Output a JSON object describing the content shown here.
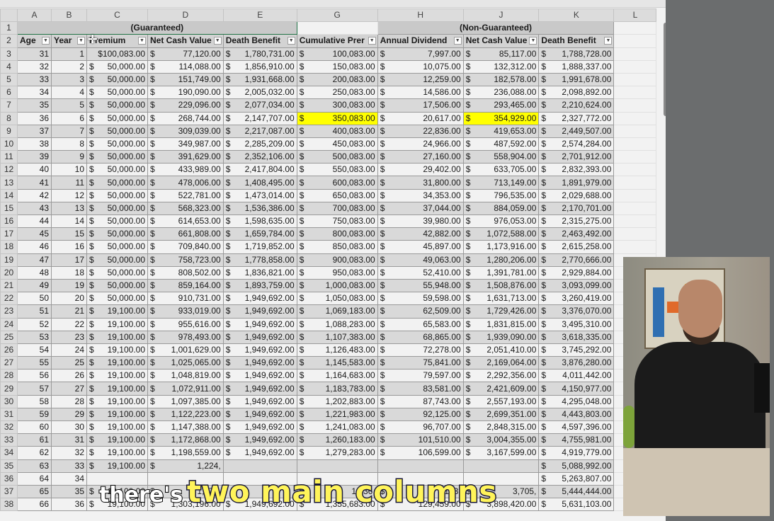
{
  "column_letters": [
    "A",
    "B",
    "C",
    "D",
    "E",
    "G",
    "H",
    "J",
    "K",
    "L"
  ],
  "group_headers": {
    "guaranteed": "(Guaranteed)",
    "non_guaranteed": "(Non-Guaranteed)"
  },
  "headers": [
    "Age",
    "Year",
    "Premium",
    "Net Cash Value",
    "Death Benefit",
    "Cumulative Prer",
    "Annual Dividend",
    "Net Cash Value",
    "Death Benefit"
  ],
  "currency_symbol": "$",
  "rows": [
    {
      "row": "3",
      "age": "31",
      "year": "1",
      "premium": "$100,083.00",
      "ncv": "77,120.00",
      "db": "1,780,731.00",
      "cum": "100,083.00",
      "div": "7,997.00",
      "ncv2": "85,117.00",
      "db2": "1,788,728.00"
    },
    {
      "row": "4",
      "age": "32",
      "year": "2",
      "premium": "50,000.00",
      "ncv": "114,088.00",
      "db": "1,856,910.00",
      "cum": "150,083.00",
      "div": "10,075.00",
      "ncv2": "132,312.00",
      "db2": "1,888,337.00"
    },
    {
      "row": "5",
      "age": "33",
      "year": "3",
      "premium": "50,000.00",
      "ncv": "151,749.00",
      "db": "1,931,668.00",
      "cum": "200,083.00",
      "div": "12,259.00",
      "ncv2": "182,578.00",
      "db2": "1,991,678.00"
    },
    {
      "row": "6",
      "age": "34",
      "year": "4",
      "premium": "50,000.00",
      "ncv": "190,090.00",
      "db": "2,005,032.00",
      "cum": "250,083.00",
      "div": "14,586.00",
      "ncv2": "236,088.00",
      "db2": "2,098,892.00"
    },
    {
      "row": "7",
      "age": "35",
      "year": "5",
      "premium": "50,000.00",
      "ncv": "229,096.00",
      "db": "2,077,034.00",
      "cum": "300,083.00",
      "div": "17,506.00",
      "ncv2": "293,465.00",
      "db2": "2,210,624.00"
    },
    {
      "row": "8",
      "age": "36",
      "year": "6",
      "premium": "50,000.00",
      "ncv": "268,744.00",
      "db": "2,147,707.00",
      "cum": "350,083.00",
      "div": "20,617.00",
      "ncv2": "354,929.00",
      "db2": "2,327,772.00",
      "highlight": true
    },
    {
      "row": "9",
      "age": "37",
      "year": "7",
      "premium": "50,000.00",
      "ncv": "309,039.00",
      "db": "2,217,087.00",
      "cum": "400,083.00",
      "div": "22,836.00",
      "ncv2": "419,653.00",
      "db2": "2,449,507.00"
    },
    {
      "row": "10",
      "age": "38",
      "year": "8",
      "premium": "50,000.00",
      "ncv": "349,987.00",
      "db": "2,285,209.00",
      "cum": "450,083.00",
      "div": "24,966.00",
      "ncv2": "487,592.00",
      "db2": "2,574,284.00"
    },
    {
      "row": "11",
      "age": "39",
      "year": "9",
      "premium": "50,000.00",
      "ncv": "391,629.00",
      "db": "2,352,106.00",
      "cum": "500,083.00",
      "div": "27,160.00",
      "ncv2": "558,904.00",
      "db2": "2,701,912.00"
    },
    {
      "row": "12",
      "age": "40",
      "year": "10",
      "premium": "50,000.00",
      "ncv": "433,989.00",
      "db": "2,417,804.00",
      "cum": "550,083.00",
      "div": "29,402.00",
      "ncv2": "633,705.00",
      "db2": "2,832,393.00"
    },
    {
      "row": "13",
      "age": "41",
      "year": "11",
      "premium": "50,000.00",
      "ncv": "478,006.00",
      "db": "1,408,495.00",
      "cum": "600,083.00",
      "div": "31,800.00",
      "ncv2": "713,149.00",
      "db2": "1,891,979.00"
    },
    {
      "row": "14",
      "age": "42",
      "year": "12",
      "premium": "50,000.00",
      "ncv": "522,781.00",
      "db": "1,473,014.00",
      "cum": "650,083.00",
      "div": "34,353.00",
      "ncv2": "796,535.00",
      "db2": "2,029,688.00"
    },
    {
      "row": "15",
      "age": "43",
      "year": "13",
      "premium": "50,000.00",
      "ncv": "568,323.00",
      "db": "1,536,386.00",
      "cum": "700,083.00",
      "div": "37,044.00",
      "ncv2": "884,059.00",
      "db2": "2,170,701.00"
    },
    {
      "row": "16",
      "age": "44",
      "year": "14",
      "premium": "50,000.00",
      "ncv": "614,653.00",
      "db": "1,598,635.00",
      "cum": "750,083.00",
      "div": "39,980.00",
      "ncv2": "976,053.00",
      "db2": "2,315,275.00"
    },
    {
      "row": "17",
      "age": "45",
      "year": "15",
      "premium": "50,000.00",
      "ncv": "661,808.00",
      "db": "1,659,784.00",
      "cum": "800,083.00",
      "div": "42,882.00",
      "ncv2": "1,072,588.00",
      "db2": "2,463,492.00"
    },
    {
      "row": "18",
      "age": "46",
      "year": "16",
      "premium": "50,000.00",
      "ncv": "709,840.00",
      "db": "1,719,852.00",
      "cum": "850,083.00",
      "div": "45,897.00",
      "ncv2": "1,173,916.00",
      "db2": "2,615,258.00"
    },
    {
      "row": "19",
      "age": "47",
      "year": "17",
      "premium": "50,000.00",
      "ncv": "758,723.00",
      "db": "1,778,858.00",
      "cum": "900,083.00",
      "div": "49,063.00",
      "ncv2": "1,280,206.00",
      "db2": "2,770,666.00"
    },
    {
      "row": "20",
      "age": "48",
      "year": "18",
      "premium": "50,000.00",
      "ncv": "808,502.00",
      "db": "1,836,821.00",
      "cum": "950,083.00",
      "div": "52,410.00",
      "ncv2": "1,391,781.00",
      "db2": "2,929,884.00"
    },
    {
      "row": "21",
      "age": "49",
      "year": "19",
      "premium": "50,000.00",
      "ncv": "859,164.00",
      "db": "1,893,759.00",
      "cum": "1,000,083.00",
      "div": "55,948.00",
      "ncv2": "1,508,876.00",
      "db2": "3,093,099.00"
    },
    {
      "row": "22",
      "age": "50",
      "year": "20",
      "premium": "50,000.00",
      "ncv": "910,731.00",
      "db": "1,949,692.00",
      "cum": "1,050,083.00",
      "div": "59,598.00",
      "ncv2": "1,631,713.00",
      "db2": "3,260,419.00"
    },
    {
      "row": "23",
      "age": "51",
      "year": "21",
      "premium": "19,100.00",
      "ncv": "933,019.00",
      "db": "1,949,692.00",
      "cum": "1,069,183.00",
      "div": "62,509.00",
      "ncv2": "1,729,426.00",
      "db2": "3,376,070.00"
    },
    {
      "row": "24",
      "age": "52",
      "year": "22",
      "premium": "19,100.00",
      "ncv": "955,616.00",
      "db": "1,949,692.00",
      "cum": "1,088,283.00",
      "div": "65,583.00",
      "ncv2": "1,831,815.00",
      "db2": "3,495,310.00"
    },
    {
      "row": "25",
      "age": "53",
      "year": "23",
      "premium": "19,100.00",
      "ncv": "978,493.00",
      "db": "1,949,692.00",
      "cum": "1,107,383.00",
      "div": "68,865.00",
      "ncv2": "1,939,090.00",
      "db2": "3,618,335.00"
    },
    {
      "row": "26",
      "age": "54",
      "year": "24",
      "premium": "19,100.00",
      "ncv": "1,001,629.00",
      "db": "1,949,692.00",
      "cum": "1,126,483.00",
      "div": "72,278.00",
      "ncv2": "2,051,410.00",
      "db2": "3,745,292.00"
    },
    {
      "row": "27",
      "age": "55",
      "year": "25",
      "premium": "19,100.00",
      "ncv": "1,025,065.00",
      "db": "1,949,692.00",
      "cum": "1,145,583.00",
      "div": "75,841.00",
      "ncv2": "2,169,064.00",
      "db2": "3,876,280.00"
    },
    {
      "row": "28",
      "age": "56",
      "year": "26",
      "premium": "19,100.00",
      "ncv": "1,048,819.00",
      "db": "1,949,692.00",
      "cum": "1,164,683.00",
      "div": "79,597.00",
      "ncv2": "2,292,356.00",
      "db2": "4,011,442.00"
    },
    {
      "row": "29",
      "age": "57",
      "year": "27",
      "premium": "19,100.00",
      "ncv": "1,072,911.00",
      "db": "1,949,692.00",
      "cum": "1,183,783.00",
      "div": "83,581.00",
      "ncv2": "2,421,609.00",
      "db2": "4,150,977.00"
    },
    {
      "row": "30",
      "age": "58",
      "year": "28",
      "premium": "19,100.00",
      "ncv": "1,097,385.00",
      "db": "1,949,692.00",
      "cum": "1,202,883.00",
      "div": "87,743.00",
      "ncv2": "2,557,193.00",
      "db2": "4,295,048.00"
    },
    {
      "row": "31",
      "age": "59",
      "year": "29",
      "premium": "19,100.00",
      "ncv": "1,122,223.00",
      "db": "1,949,692.00",
      "cum": "1,221,983.00",
      "div": "92,125.00",
      "ncv2": "2,699,351.00",
      "db2": "4,443,803.00"
    },
    {
      "row": "32",
      "age": "60",
      "year": "30",
      "premium": "19,100.00",
      "ncv": "1,147,388.00",
      "db": "1,949,692.00",
      "cum": "1,241,083.00",
      "div": "96,707.00",
      "ncv2": "2,848,315.00",
      "db2": "4,597,396.00"
    },
    {
      "row": "33",
      "age": "61",
      "year": "31",
      "premium": "19,100.00",
      "ncv": "1,172,868.00",
      "db": "1,949,692.00",
      "cum": "1,260,183.00",
      "div": "101,510.00",
      "ncv2": "3,004,355.00",
      "db2": "4,755,981.00"
    },
    {
      "row": "34",
      "age": "62",
      "year": "32",
      "premium": "19,100.00",
      "ncv": "1,198,559.00",
      "db": "1,949,692.00",
      "cum": "1,279,283.00",
      "div": "106,599.00",
      "ncv2": "3,167,599.00",
      "db2": "4,919,779.00"
    },
    {
      "row": "35",
      "age": "63",
      "year": "33",
      "premium": "19,100.00",
      "ncv": "1,224,",
      "db": "",
      "cum": "",
      "div": "",
      "ncv2": "",
      "db2": "5,088,992.00"
    },
    {
      "row": "36",
      "age": "64",
      "year": "34",
      "premium": "",
      "ncv": "",
      "db": "",
      "cum": "",
      "div": "",
      "ncv2": "",
      "db2": "5,263,807.00"
    },
    {
      "row": "37",
      "age": "65",
      "year": "35",
      "premium": "19,100.00",
      "ncv": "1,276,",
      "db": "",
      "cum": "1,336,",
      "div": "123,",
      "ncv2": "3,705,",
      "db2": "5,444,444.00"
    },
    {
      "row": "38",
      "age": "66",
      "year": "36",
      "premium": "19,100.00",
      "ncv": "1,303,196.00",
      "db": "1,949,692.00",
      "cum": "1,355,683.00",
      "div": "129,459.00",
      "ncv2": "3,898,420.00",
      "db2": "5,631,103.00"
    }
  ],
  "caption": {
    "part1": "there's",
    "part2": "two main columns"
  },
  "colors": {
    "highlight": "#ffff00",
    "group_border": "#217346",
    "caption_yellow": "#fff45a"
  }
}
